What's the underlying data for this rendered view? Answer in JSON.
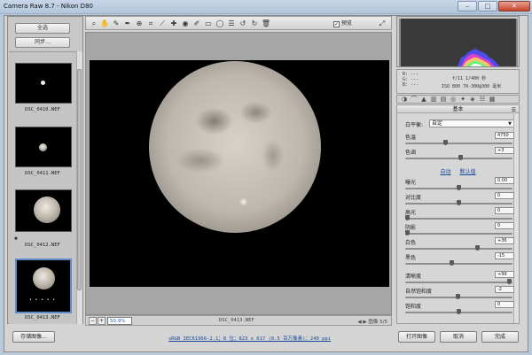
{
  "window": {
    "title": "Camera Raw 8.7 -  Nikon D80",
    "minimize": "–",
    "maximize": "□",
    "close": "✕"
  },
  "filmstrip": {
    "select_all": "全选",
    "synchronize": "同步...",
    "items": [
      {
        "name": "DSC_0410.NEF"
      },
      {
        "name": "DSC_0411.NEF"
      },
      {
        "name": "DSC_0412.NEF"
      },
      {
        "name": "DSC_0413.NEF",
        "selected": true,
        "rating_dots": "• • • • •"
      }
    ]
  },
  "toolbar": {
    "tools": [
      "zoom-icon",
      "hand-icon",
      "white-balance-icon",
      "color-sampler-icon",
      "target-adjust-icon",
      "crop-icon",
      "straighten-icon",
      "spot-removal-icon",
      "red-eye-icon",
      "adjust-brush-icon",
      "graduated-filter-icon",
      "radial-filter-icon",
      "preferences-icon",
      "rotate-left-icon",
      "rotate-right-icon",
      "trash-icon"
    ],
    "preview_label": "预览",
    "preview_checked": true
  },
  "status": {
    "zoom_value": "50.9%",
    "filename": "DSC_0413.NEF",
    "image_label": "图像",
    "image_count": "5/5"
  },
  "info": {
    "r_label": "R:",
    "r_value": "---",
    "g_label": "G:",
    "g_value": "---",
    "b_label": "B:",
    "b_value": "---",
    "aperture_shutter": "f/11   1/400 秒",
    "iso_lens": "ISO 800   70-300@300 毫米"
  },
  "panel": {
    "title": "基本",
    "white_balance_label": "白平衡:",
    "white_balance_value": "自定",
    "auto_link": "自动",
    "default_link": "默认值",
    "sliders": [
      {
        "label": "色温",
        "value": "4750",
        "level": 0.37
      },
      {
        "label": "色调",
        "value": "+3",
        "level": 0.52
      },
      {
        "label": "曝光",
        "value": "0.00",
        "level": 0.5
      },
      {
        "label": "对比度",
        "value": "0",
        "level": 0.5
      },
      {
        "label": "高光",
        "value": "0",
        "level": 0.0
      },
      {
        "label": "阴影",
        "value": "0",
        "level": 0.0
      },
      {
        "label": "白色",
        "value": "+36",
        "level": 0.68
      },
      {
        "label": "黑色",
        "value": "-15",
        "level": 0.43
      },
      {
        "label": "清晰度",
        "value": "+99",
        "level": 0.99
      },
      {
        "label": "自然饱和度",
        "value": "-2",
        "level": 0.49
      },
      {
        "label": "饱和度",
        "value": "0",
        "level": 0.5
      }
    ]
  },
  "bottom": {
    "save_button": "存储图像...",
    "workflow_link": "sRGB IEC61966-2.1；8 位；823 x 617 (0.5 百万像素)；240 ppi",
    "open_button": "打开图像",
    "cancel_button": "取消",
    "done_button": "完成"
  },
  "colors": {
    "accent": "#5e8bc9",
    "canvas": "#000000",
    "chrome": "#d4d4d4"
  }
}
